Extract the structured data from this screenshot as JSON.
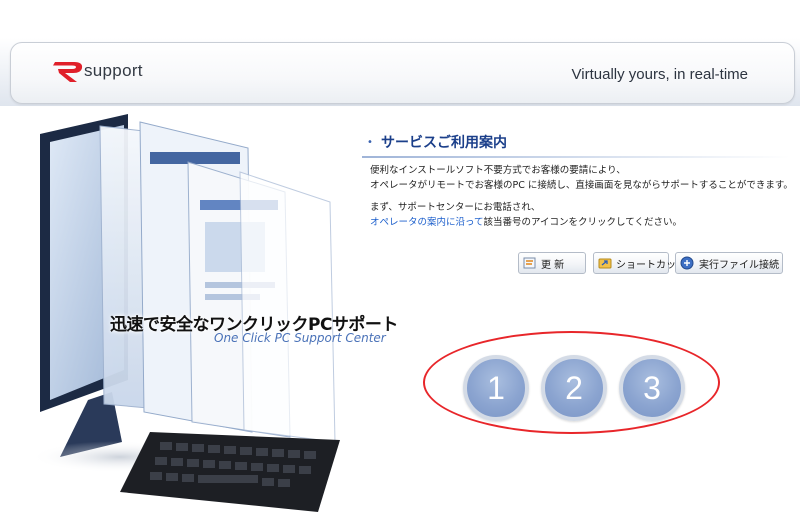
{
  "header": {
    "logo_text": "support",
    "tagline": "Virtually yours, in real-time"
  },
  "hero": {
    "title": "迅速で安全なワンクリックPCサポート",
    "subtitle": "One Click PC Support Center"
  },
  "guide": {
    "title": "サービスご利用案内",
    "paragraph1_line1": "便利なインストールソフト不要方式でお客様の要請により、",
    "paragraph1_line2": "オペレータがリモートでお客様のPC に接続し、直接画面を見ながらサポートすることができます。",
    "paragraph2_line1": "まず、サポートセンターにお電話され、",
    "paragraph2_link": "オペレータの案内に沿って",
    "paragraph2_rest": "該当番号のアイコンをクリックしてください。"
  },
  "buttons": {
    "refresh": "更 新",
    "shortcut": "ショートカット",
    "exec": "実行ファイル接続"
  },
  "numbers": [
    "1",
    "2",
    "3"
  ],
  "colors": {
    "accent_blue": "#1b3f8a",
    "link_blue": "#1c5fcc",
    "circle_blue": "#8ba4d0",
    "highlight_red": "#e8262a"
  }
}
